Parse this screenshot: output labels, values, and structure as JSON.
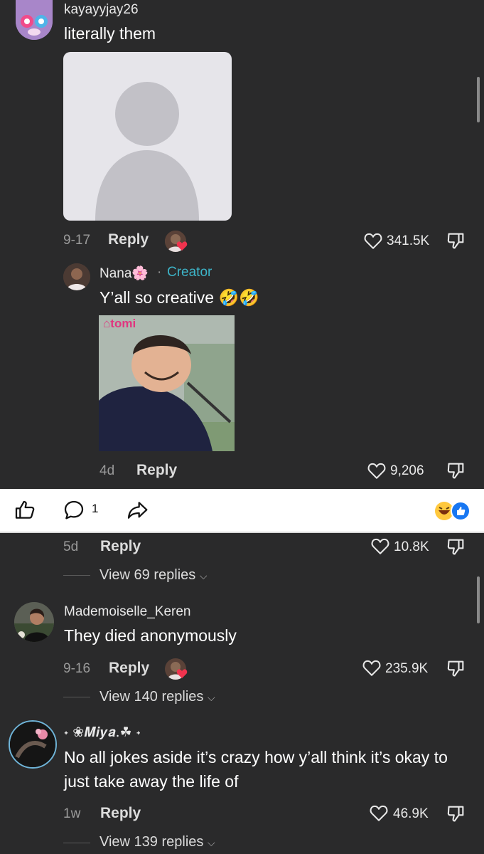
{
  "top_section": {
    "comment1": {
      "username": "kayayyjay26",
      "text": "literally them",
      "date": "9-17",
      "reply_label": "Reply",
      "likes": "341.5K"
    },
    "creator_reply": {
      "username": "Nana🌸",
      "separator": "·",
      "creator_badge": "Creator",
      "text": "Y’all so creative 🤣🤣",
      "sticker_brand": "tomi",
      "date": "4d",
      "reply_label": "Reply",
      "likes": "9,206"
    }
  },
  "action_bar": {
    "comment_count": "1"
  },
  "bottom_section": {
    "prev_footer": {
      "date": "5d",
      "reply_label": "Reply",
      "likes": "10.8K",
      "view_replies": "View 69 replies"
    },
    "comment2": {
      "username": "Mademoiselle_Keren",
      "text": "They died anonymously",
      "date": "9-16",
      "reply_label": "Reply",
      "likes": "235.9K",
      "view_replies": "View 140 replies"
    },
    "comment3": {
      "username": "˖ ❀𝑴𝒊𝒚𝒂.☘︎ ˖",
      "text": "No all jokes aside it’s crazy how y’all think it’s okay to just take away the life of",
      "date": "1w",
      "reply_label": "Reply",
      "likes": "46.9K",
      "view_replies": "View 139 replies"
    }
  },
  "colors": {
    "background": "#2a2a2b",
    "creator_accent": "#3db4c8",
    "action_bar_bg": "#ffffff"
  }
}
